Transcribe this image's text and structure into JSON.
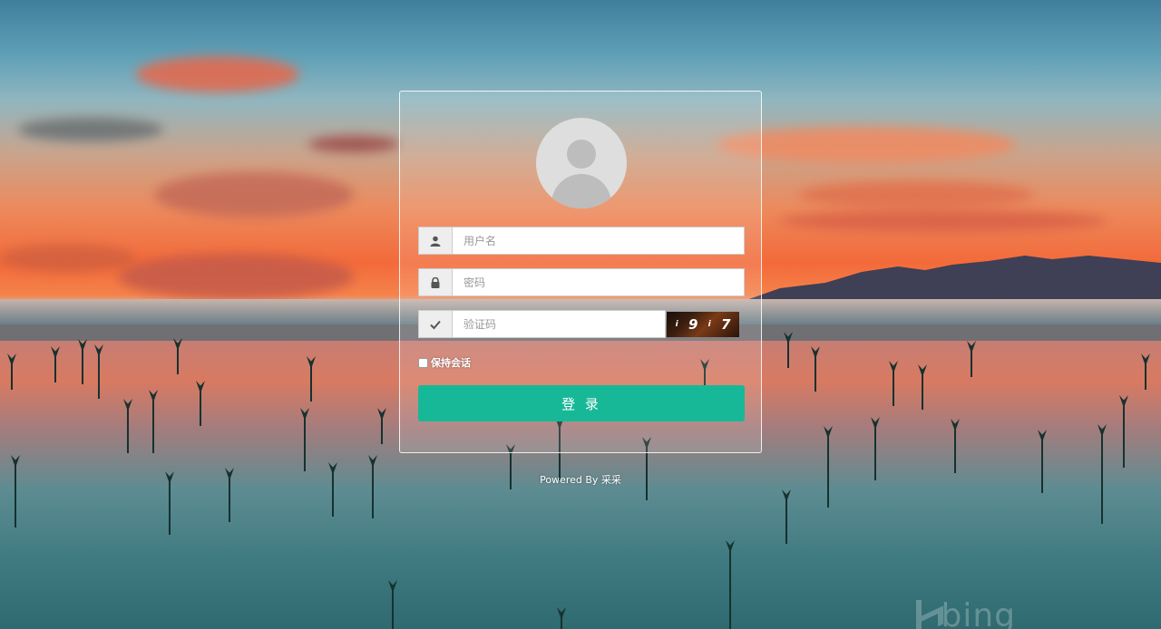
{
  "login": {
    "username_placeholder": "用户名",
    "username_value": "",
    "password_placeholder": "密码",
    "password_value": "",
    "captcha_placeholder": "验证码",
    "captcha_value": "",
    "captcha_chars": [
      "i",
      "9",
      "i",
      "7"
    ],
    "remember_label": "保持会话",
    "remember_checked": false,
    "submit_label": "登 录"
  },
  "footer": {
    "powered_by": "Powered By 采采"
  },
  "background": {
    "watermark": "bing"
  },
  "icons": {
    "username": "user-icon",
    "password": "lock-icon",
    "captcha": "check-icon",
    "avatar": "avatar-placeholder-icon"
  },
  "colors": {
    "primary": "#17b897",
    "addon_bg": "#eeeeee"
  }
}
